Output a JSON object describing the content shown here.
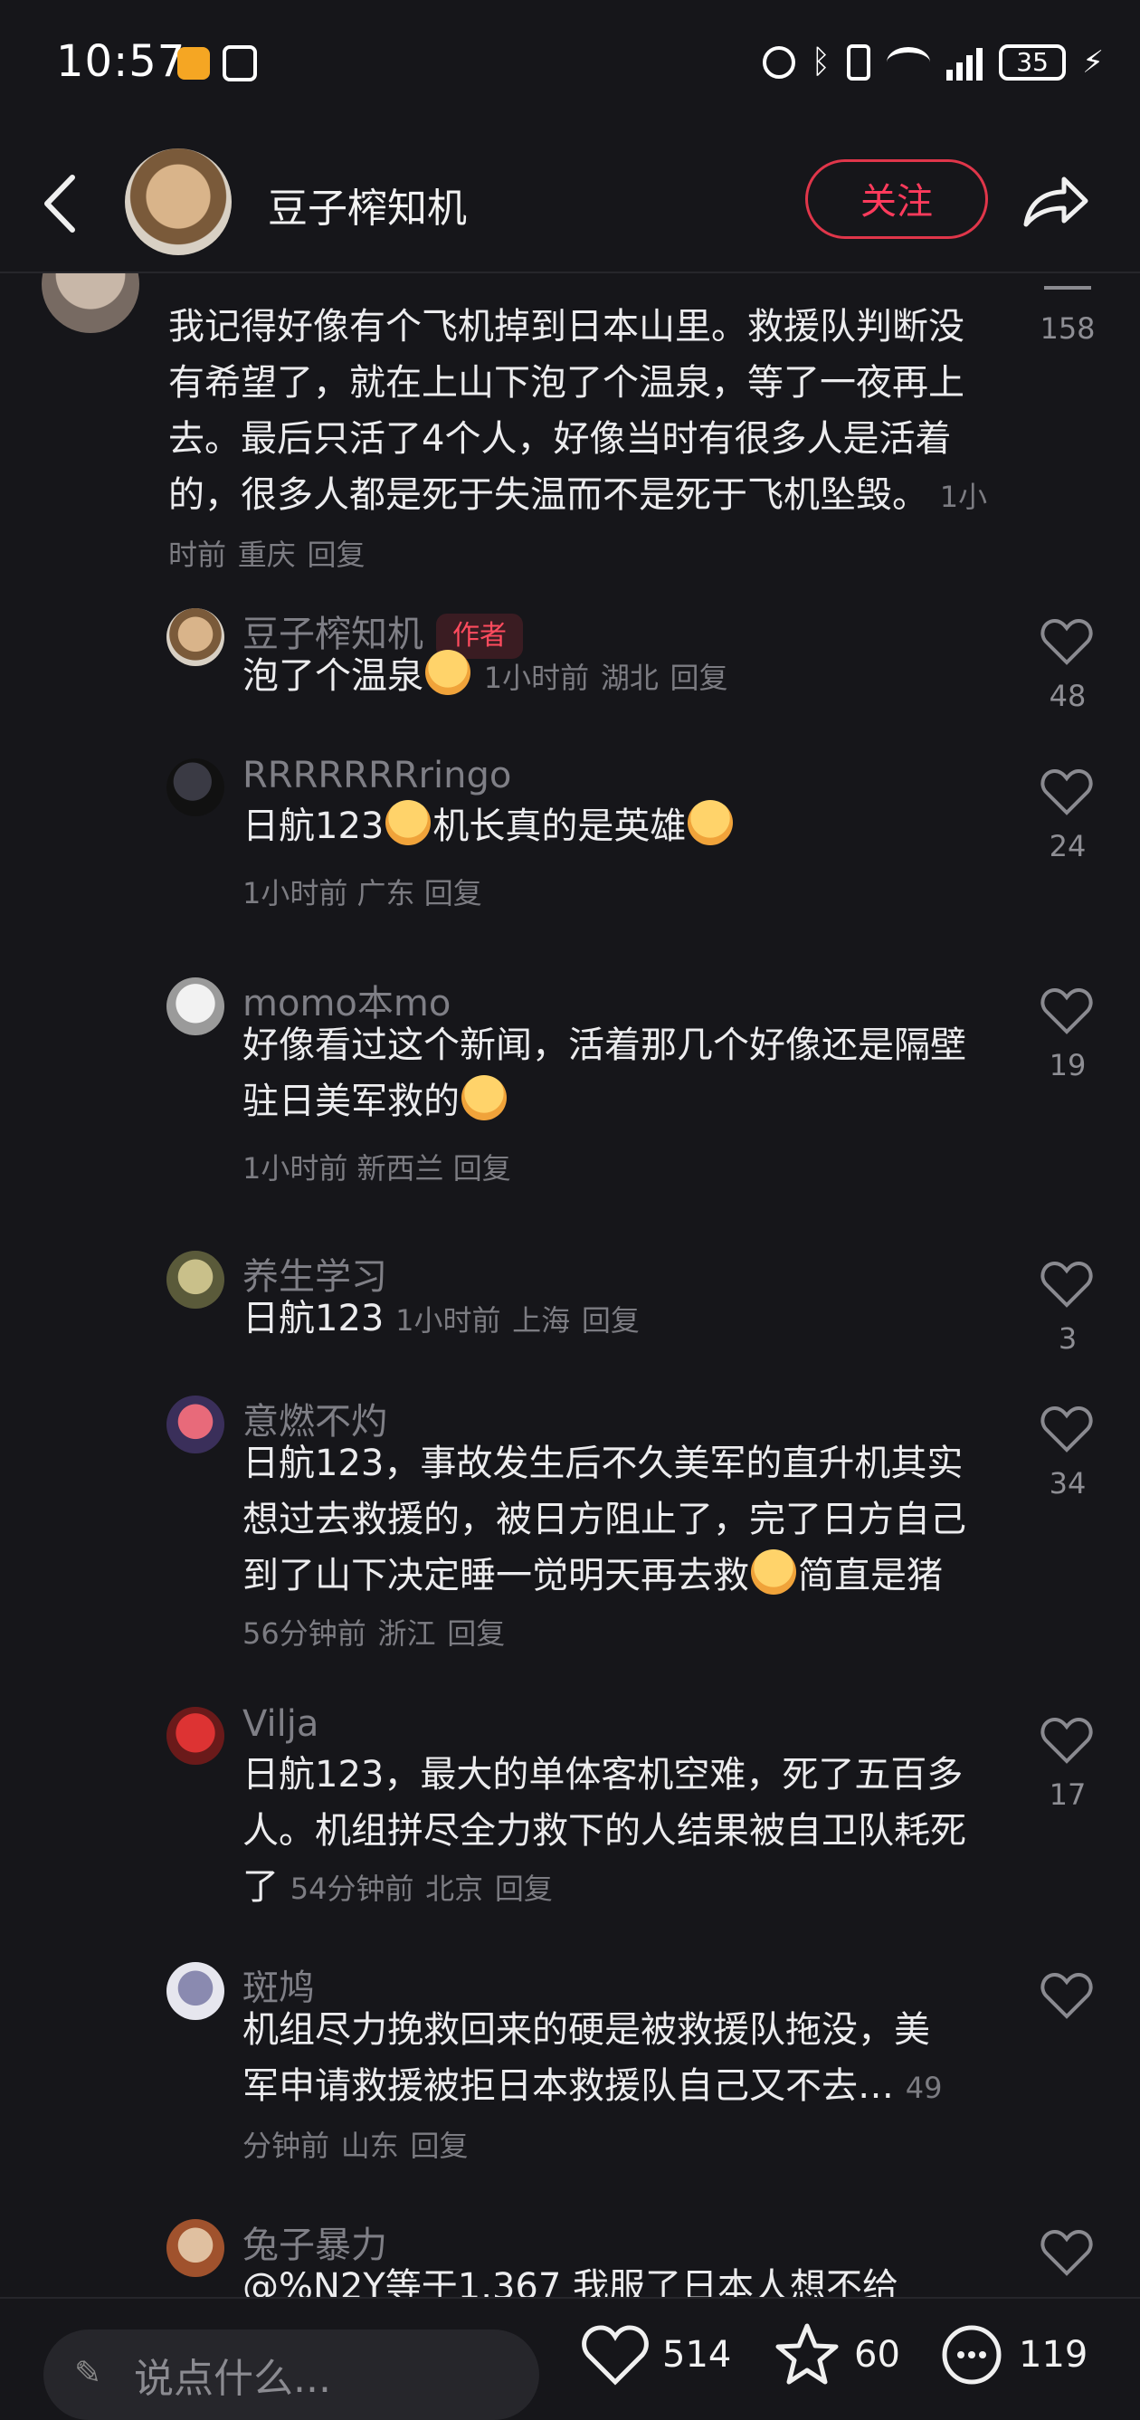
{
  "status_bar": {
    "time": "10:57",
    "battery": "35"
  },
  "header": {
    "back_icon": "chevron-left-icon",
    "author": "豆子榨知机",
    "follow_label": "关注",
    "share_icon": "share-arrow-icon"
  },
  "top_comment": {
    "likes": "158",
    "text": "我记得好像有个飞机掉到日本山里。救援队判断没有希望了，就在上山下泡了个温泉，等了一夜再上去。最后只活了4个人，好像当时有很多人是活着的，很多人都是死于失温而不是死于飞机坠毁。",
    "time": "1小时前",
    "location": "重庆",
    "reply_label": "回复"
  },
  "replies": [
    {
      "name": "豆子榨知机",
      "tag": "作者",
      "text": "泡了个温泉",
      "time": "1小时前",
      "location": "湖北",
      "reply": "回复",
      "likes": "48"
    },
    {
      "name": "RRRRRRRringo",
      "text1": "日航123",
      "text2": "机长真的是英雄",
      "time": "1小时前",
      "location": "广东",
      "reply": "回复",
      "likes": "24"
    },
    {
      "name": "momo本mo",
      "text": "好像看过这个新闻，活着那几个好像还是隔壁驻日美军救的",
      "time": "1小时前",
      "location": "新西兰",
      "reply": "回复",
      "likes": "19"
    },
    {
      "name": "养生学习",
      "text": "日航123",
      "time": "1小时前",
      "location": "上海",
      "reply": "回复",
      "likes": "3"
    },
    {
      "name": "意燃不灼",
      "text": "日航123，事故发生后不久美军的直升机其实想过去救援的，被日方阻止了，完了日方自己到了山下决定睡一觉明天再去救",
      "text_tail": "简直是猪",
      "time": "56分钟前",
      "location": "浙江",
      "reply": "回复",
      "likes": "34"
    },
    {
      "name": "Vilja",
      "text": "日航123，最大的单体客机空难，死了五百多人。机组拼尽全力救下的人结果被自卫队耗死了",
      "time": "54分钟前",
      "location": "北京",
      "reply": "回复",
      "likes": "17"
    },
    {
      "name": "斑鸠",
      "text": "机组尽力挽救回来的硬是被救援队拖没，美军申请救援被拒日本救援队自己又不去…",
      "time": "49分钟前",
      "location": "山东",
      "reply": "回复"
    },
    {
      "name": "兔子暴力",
      "text": "@%N2Y等于1.367 我服了日本人想不给"
    }
  ],
  "bottom_bar": {
    "placeholder": "说点什么...",
    "likes": "514",
    "favorites": "60",
    "comments": "119"
  }
}
